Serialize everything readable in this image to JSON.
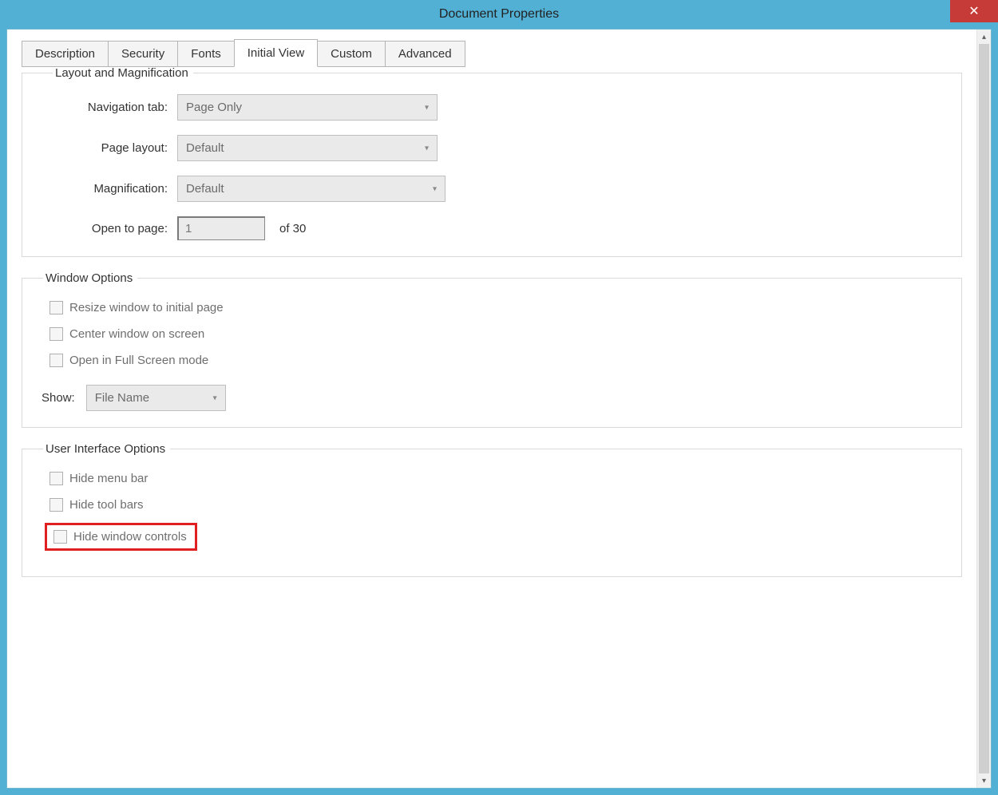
{
  "window": {
    "title": "Document Properties",
    "close": "✕"
  },
  "tabs": [
    "Description",
    "Security",
    "Fonts",
    "Initial View",
    "Custom",
    "Advanced"
  ],
  "layout_group": {
    "legend": "Layout and Magnification",
    "nav_label": "Navigation tab:",
    "nav_value": "Page Only",
    "page_layout_label": "Page layout:",
    "page_layout_value": "Default",
    "mag_label": "Magnification:",
    "mag_value": "Default",
    "open_label": "Open to page:",
    "open_value": "1",
    "of_text": "of 30"
  },
  "window_options": {
    "legend": "Window Options",
    "resize": "Resize window to initial page",
    "center": "Center window on screen",
    "fullscreen": "Open in Full Screen mode",
    "show_label": "Show:",
    "show_value": "File Name"
  },
  "ui_options": {
    "legend": "User Interface Options",
    "hide_menu": "Hide menu bar",
    "hide_tool": "Hide tool bars",
    "hide_controls": "Hide window controls"
  }
}
